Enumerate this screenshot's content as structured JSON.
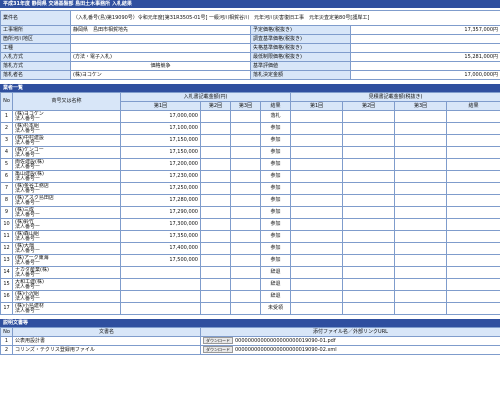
{
  "title": "平成31年度 静岡県 交通基盤部 島田土木事務所 入札結果",
  "info": {
    "rows": [
      {
        "l1": "業件名",
        "v1": "（入札番号(島)第19090号）令和元年度[第31R3505-01号] 一級河川相賀谷川　元年河川災害復旧工事　元年災査定第80号[護岸工]",
        "l2": "",
        "v2": ""
      },
      {
        "l1": "工事場所",
        "v1": "静岡県　島田市相賀地先",
        "l2": "予定価格(税抜き)",
        "v2": "17,357,000円"
      },
      {
        "l1": "箇所河川地区",
        "v1": "",
        "l2": "調査基準価格(税抜き)",
        "v2": ""
      },
      {
        "l1": "工種",
        "v1": "",
        "l2": "失格基準価格(税抜き)",
        "v2": ""
      },
      {
        "l1": "入札方式",
        "v1": "(方法・電子入札)",
        "l2": "最低制限価格(税抜き)",
        "v2": "15,281,000円"
      },
      {
        "l1": "落札方式",
        "v1": "価格競争",
        "l2": "基準評価値",
        "v2": ""
      },
      {
        "l1": "落札者名",
        "v1": "(株)ヨコケン",
        "l2": "落札決定金額",
        "v2": "17,000,000円"
      }
    ]
  },
  "bidders_title": "業者一覧",
  "bid_headers": {
    "no": "No",
    "name": "商号又は名称",
    "group1": "入札書記載金額(円)",
    "group2": "見積書記載金額(税抜き)",
    "round1": "第1回",
    "round2": "第2回",
    "round3": "第3回",
    "result": "結果"
  },
  "bidders": [
    {
      "no": "1",
      "name": "(株)ヨコケン",
      "sub": "法人番号ー",
      "amount": "17,000,000",
      "result": "落札"
    },
    {
      "no": "2",
      "name": "(株)杉本組",
      "sub": "法人番号ー",
      "amount": "17,100,000",
      "result": "参加"
    },
    {
      "no": "3",
      "name": "(株)中村建設",
      "sub": "法人番号ー",
      "amount": "17,150,000",
      "result": "参加"
    },
    {
      "no": "4",
      "name": "(株)ケンコー",
      "sub": "法人番号ー",
      "amount": "17,150,000",
      "result": "参加"
    },
    {
      "no": "5",
      "name": "両佐建設(株)",
      "sub": "法人番号ー",
      "amount": "17,200,000",
      "result": "参加"
    },
    {
      "no": "6",
      "name": "亀山建設(株)",
      "sub": "法人番号ー",
      "amount": "17,230,000",
      "result": "参加"
    },
    {
      "no": "7",
      "name": "(株)金谷工務店",
      "sub": "法人番号ー",
      "amount": "17,250,000",
      "result": "参加"
    },
    {
      "no": "8",
      "name": "(株)アスク島田店",
      "sub": "法人番号ー",
      "amount": "17,280,000",
      "result": "参加"
    },
    {
      "no": "9",
      "name": "(株)三成",
      "sub": "法人番号ー",
      "amount": "17,290,000",
      "result": "参加"
    },
    {
      "no": "10",
      "name": "(株)鈴竹",
      "sub": "法人番号ー",
      "amount": "17,300,000",
      "result": "参加"
    },
    {
      "no": "11",
      "name": "(株)森山組",
      "sub": "法人番号ー",
      "amount": "17,350,000",
      "result": "参加"
    },
    {
      "no": "12",
      "name": "(株)大畑",
      "sub": "法人番号ー",
      "amount": "17,400,000",
      "result": "参加"
    },
    {
      "no": "13",
      "name": "(株)アーク東海",
      "sub": "法人番号ー",
      "amount": "17,500,000",
      "result": "参加"
    },
    {
      "no": "14",
      "name": "ナカダ産業(株)",
      "sub": "法人番号ー",
      "amount": "",
      "result": "辞退"
    },
    {
      "no": "15",
      "name": "大和工建(株)",
      "sub": "法人番号ー",
      "amount": "",
      "result": "辞退"
    },
    {
      "no": "16",
      "name": "(株)小沢組",
      "sub": "法人番号ー",
      "amount": "",
      "result": "辞退"
    },
    {
      "no": "17",
      "name": "(株)小島建材",
      "sub": "法人番号ー",
      "amount": "",
      "result": "未受領"
    }
  ],
  "docs_title": "説明文書等",
  "doc_headers": {
    "no": "No",
    "name": "文書名",
    "file": "添付ファイル名／外部リンクURL"
  },
  "docs": [
    {
      "no": "1",
      "name": "公表用設計書",
      "button": "ダウンロード",
      "file": "00000000000000000000019090-01.pdf"
    },
    {
      "no": "2",
      "name": "コリンズ・テクリス登録用ファイル",
      "button": "ダウンロード",
      "file": "00000000000000000000019090-02.xml"
    }
  ]
}
